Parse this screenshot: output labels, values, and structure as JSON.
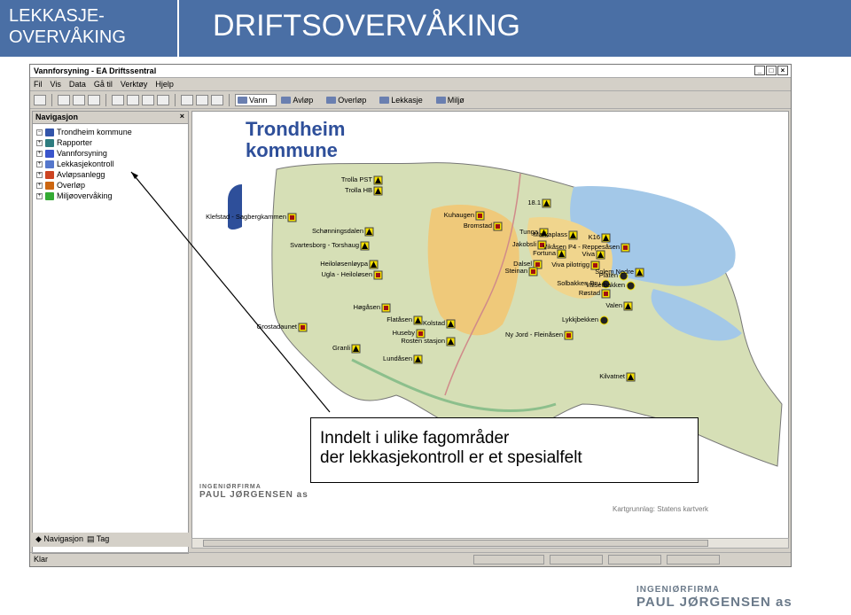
{
  "slide": {
    "left_title": "LEKKASJE- OVERVÅKING",
    "right_title": "DRIFTSOVERVÅKING"
  },
  "window": {
    "title": "Vannforsyning - EA Driftssentral",
    "menus": [
      "Fil",
      "Vis",
      "Data",
      "Gå til",
      "Verktøy",
      "Hjelp"
    ],
    "tabs": [
      "Vann",
      "Avløp",
      "Overløp",
      "Lekkasje",
      "Miljø"
    ],
    "status": "Klar"
  },
  "nav": {
    "header": "Navigasjon",
    "items": [
      {
        "label": "Trondheim kommune",
        "color": "#3355aa"
      },
      {
        "label": "Rapporter",
        "color": "#2e7d80"
      },
      {
        "label": "Vannforsyning",
        "color": "#3a55cc"
      },
      {
        "label": "Lekkasjekontroll",
        "color": "#5577cc"
      },
      {
        "label": "Avløpsanlegg",
        "color": "#cc4422"
      },
      {
        "label": "Overløp",
        "color": "#cc6611"
      },
      {
        "label": "Miljøovervåking",
        "color": "#33aa33"
      }
    ],
    "bottom_tabs": [
      "Navigasjon",
      "Tag"
    ]
  },
  "map": {
    "logo_top": "Trondheim",
    "logo_bottom": "kommune",
    "credit_top": "INGENIØRFIRMA",
    "credit_bottom": "PAUL JØRGENSEN as",
    "attribution": "Kartgrunnlag: Statens kartverk",
    "stations": [
      {
        "name": "Trolla PST",
        "type": "tri"
      },
      {
        "name": "Trolla HB",
        "type": "tri"
      },
      {
        "name": "Klefstad - Sagbergkammen",
        "type": "sq"
      },
      {
        "name": "Schønningsdalen",
        "type": "tri"
      },
      {
        "name": "Svartesborg - Torshaug",
        "type": "tri"
      },
      {
        "name": "Heiloløsenløypa",
        "type": "tri"
      },
      {
        "name": "Ugla - Heiloløsen",
        "type": "sq"
      },
      {
        "name": "Høgåsen",
        "type": "sq"
      },
      {
        "name": "Grostadaunet",
        "type": "sq"
      },
      {
        "name": "Flatåsen",
        "type": "tri"
      },
      {
        "name": "Kolstad",
        "type": "tri"
      },
      {
        "name": "Huseby",
        "type": "sq"
      },
      {
        "name": "Rosten stasjon",
        "type": "tri"
      },
      {
        "name": "Granli",
        "type": "tri"
      },
      {
        "name": "Lundåsen",
        "type": "tri"
      },
      {
        "name": "Kuhaugen",
        "type": "sq"
      },
      {
        "name": "Bromstad",
        "type": "sq"
      },
      {
        "name": "18.1",
        "type": "tri"
      },
      {
        "name": "Tunga",
        "type": "tri"
      },
      {
        "name": "Markaplass",
        "type": "tri"
      },
      {
        "name": "K16",
        "type": "tri"
      },
      {
        "name": "Jakobsli",
        "type": "sq"
      },
      {
        "name": "Vikåsen P4 - Reppesåsen",
        "type": "sq"
      },
      {
        "name": "Fortuna",
        "type": "tri"
      },
      {
        "name": "Viva",
        "type": "tri"
      },
      {
        "name": "Dalsel",
        "type": "sq"
      },
      {
        "name": "Viva pilotrigg",
        "type": "sq"
      },
      {
        "name": "Steinan",
        "type": "sq"
      },
      {
        "name": "Platen",
        "type": "circ"
      },
      {
        "name": "Solem Nedre",
        "type": "tri"
      },
      {
        "name": "Solbakken Bru",
        "type": "circ"
      },
      {
        "name": "Valsetbakken",
        "type": "circ"
      },
      {
        "name": "Røstad",
        "type": "sq"
      },
      {
        "name": "Valen",
        "type": "tri"
      },
      {
        "name": "Lykkjbekken",
        "type": "circ"
      },
      {
        "name": "Ny Jord - Fleinåsen",
        "type": "sq"
      },
      {
        "name": "Kilvatnet",
        "type": "tri"
      }
    ]
  },
  "callout": {
    "line1": "Inndelt i ulike fagområder",
    "line2": "der lekkasjekontroll er et spesialfelt"
  },
  "footer": {
    "company_top": "INGENIØRFIRMA",
    "company_bottom": "PAUL JØRGENSEN as"
  }
}
